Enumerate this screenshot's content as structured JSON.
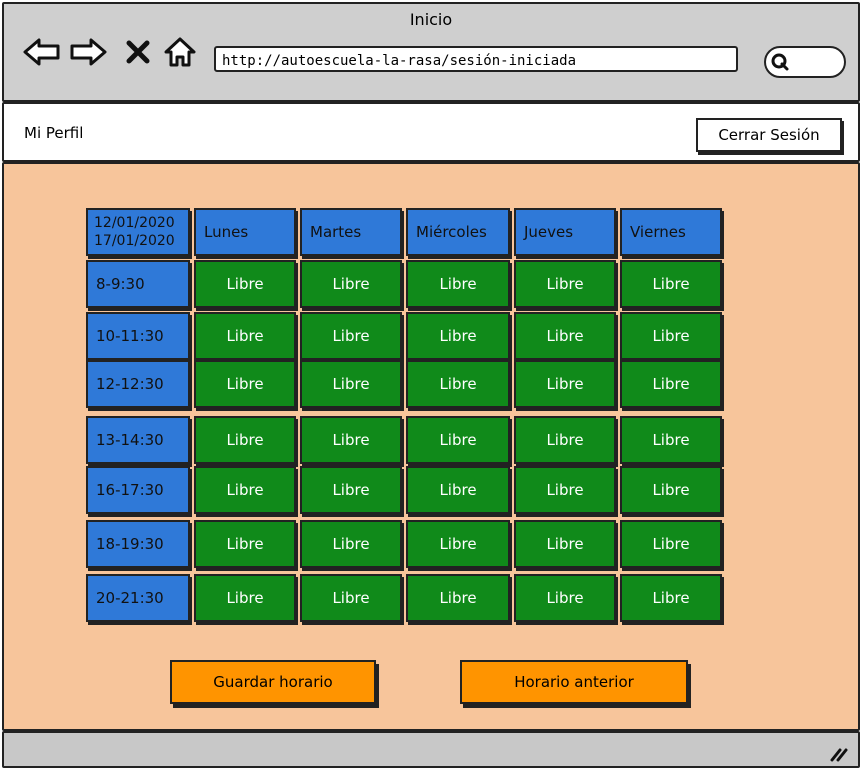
{
  "window": {
    "title": "Inicio"
  },
  "browser": {
    "url": "http://autoescuela-la-rasa/sesión-iniciada"
  },
  "header": {
    "profile_label": "Mi Perfil",
    "logout_label": "Cerrar Sesión"
  },
  "schedule": {
    "date_range": {
      "start": "12/01/2020",
      "end": "17/01/2020"
    },
    "days": [
      "Lunes",
      "Martes",
      "Miércoles",
      "Jueves",
      "Viernes"
    ],
    "slots": [
      "8-9:30",
      "10-11:30",
      "12-12:30",
      "13-14:30",
      "16-17:30",
      "18-19:30",
      "20-21:30"
    ],
    "cells": [
      [
        "Libre",
        "Libre",
        "Libre",
        "Libre",
        "Libre"
      ],
      [
        "Libre",
        "Libre",
        "Libre",
        "Libre",
        "Libre"
      ],
      [
        "Libre",
        "Libre",
        "Libre",
        "Libre",
        "Libre"
      ],
      [
        "Libre",
        "Libre",
        "Libre",
        "Libre",
        "Libre"
      ],
      [
        "Libre",
        "Libre",
        "Libre",
        "Libre",
        "Libre"
      ],
      [
        "Libre",
        "Libre",
        "Libre",
        "Libre",
        "Libre"
      ],
      [
        "Libre",
        "Libre",
        "Libre",
        "Libre",
        "Libre"
      ]
    ]
  },
  "actions": {
    "save_label": "Guardar horario",
    "previous_label": "Horario anterior"
  },
  "colors": {
    "background": "#f7c59b",
    "header_cell": "#2f79d8",
    "free_cell": "#108a1a",
    "action_button": "#ff9400"
  }
}
